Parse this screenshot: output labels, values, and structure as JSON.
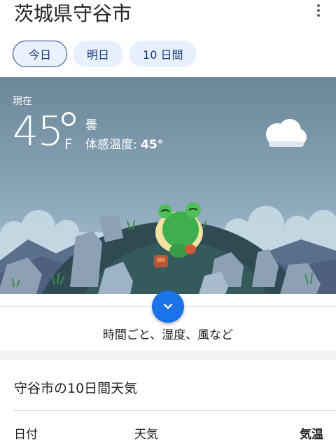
{
  "location": {
    "title": "茨城県守谷市"
  },
  "tabs": [
    {
      "label": "今日",
      "active": true
    },
    {
      "label": "明日",
      "active": false
    },
    {
      "label": "10 日間",
      "active": false
    }
  ],
  "current": {
    "label": "現在",
    "temperature": "45",
    "unit": "F",
    "condition": "曇",
    "feels_like_label": "体感温度: ",
    "feels_like_value": "45°"
  },
  "more_details": {
    "label": "時間ごと、湿度、風など"
  },
  "forecast": {
    "title": "守谷市の10日間天気",
    "columns": [
      "日付",
      "天気",
      "気温"
    ]
  },
  "colors": {
    "accent": "#1a73e8",
    "tab_bg": "#e8f0fe",
    "sky_top": "#6f8a9e",
    "sky_bottom": "#a9c4d6"
  },
  "icons": [
    "more-vert-icon",
    "cloud-icon",
    "chevron-down-icon"
  ]
}
